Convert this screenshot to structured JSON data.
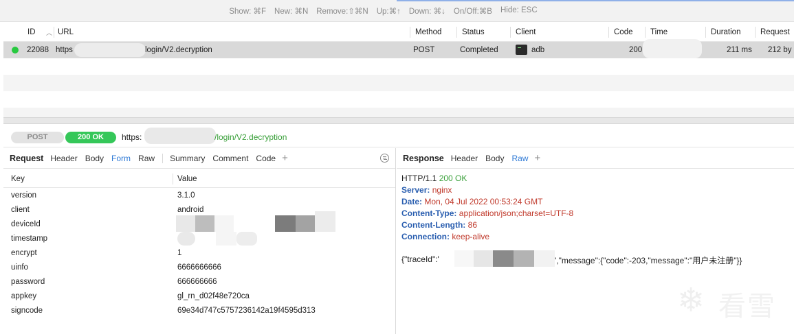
{
  "hints": [
    "Show: ⌘F",
    "New: ⌘N",
    "Remove:⇧⌘N",
    "Up:⌘↑",
    "Down: ⌘↓",
    "On/Off:⌘B",
    "Hide: ESC"
  ],
  "table": {
    "columns": [
      "ID",
      "URL",
      "Method",
      "Status",
      "Client",
      "Code",
      "Time",
      "Duration",
      "Request"
    ],
    "rows": [
      {
        "id": "22088",
        "url_prefix": "https",
        "url_suffix": "login/V2.decryption",
        "method": "POST",
        "status": "Completed",
        "client": "adb",
        "code": "200",
        "time": "",
        "duration": "211 ms",
        "request": "212 by"
      }
    ]
  },
  "urlbar": {
    "method": "POST",
    "status": "200 OK",
    "url_prefix": "https:",
    "url_suffix": "/login/V2.decryption"
  },
  "request_panel": {
    "title": "Request",
    "tabs": [
      "Header",
      "Body",
      "Form",
      "Raw",
      "Summary",
      "Comment",
      "Code"
    ],
    "active_tab": "Form",
    "columns": [
      "Key",
      "Value"
    ],
    "params": [
      {
        "key": "version",
        "value": "3.1.0"
      },
      {
        "key": "client",
        "value": "android"
      },
      {
        "key": "deviceId",
        "value": ""
      },
      {
        "key": "timestamp",
        "value": ""
      },
      {
        "key": "encrypt",
        "value": "1"
      },
      {
        "key": "uinfo",
        "value": "6666666666"
      },
      {
        "key": "password",
        "value": "666666666"
      },
      {
        "key": "appkey",
        "value": "gl_rn_d02f48e720ca"
      },
      {
        "key": "signcode",
        "value": "69e34d747c5757236142a19f4595d313"
      }
    ]
  },
  "response_panel": {
    "title": "Response",
    "tabs": [
      "Header",
      "Body",
      "Raw"
    ],
    "active_tab": "Raw",
    "status_line": {
      "proto": "HTTP/1.1",
      "code": "200 OK"
    },
    "headers": [
      {
        "name": "Server:",
        "value": "nginx"
      },
      {
        "name": "Date:",
        "value": "Mon, 04 Jul 2022 00:53:24 GMT"
      },
      {
        "name": "Content-Type:",
        "value": "application/json;charset=UTF-8"
      },
      {
        "name": "Content-Length:",
        "value": "86"
      },
      {
        "name": "Connection:",
        "value": "keep-alive"
      }
    ],
    "body_prefix": "{\"traceId\":'",
    "body_suffix": "',\"message\":{\"code\":-203,\"message\":\"用户未注册\"}}"
  },
  "watermark": {
    "text": "看雪"
  },
  "colors": {
    "accent": "#2f7ad6",
    "ok": "#35c759",
    "header_name": "#2b5fb0",
    "header_value": "#c0392b"
  }
}
